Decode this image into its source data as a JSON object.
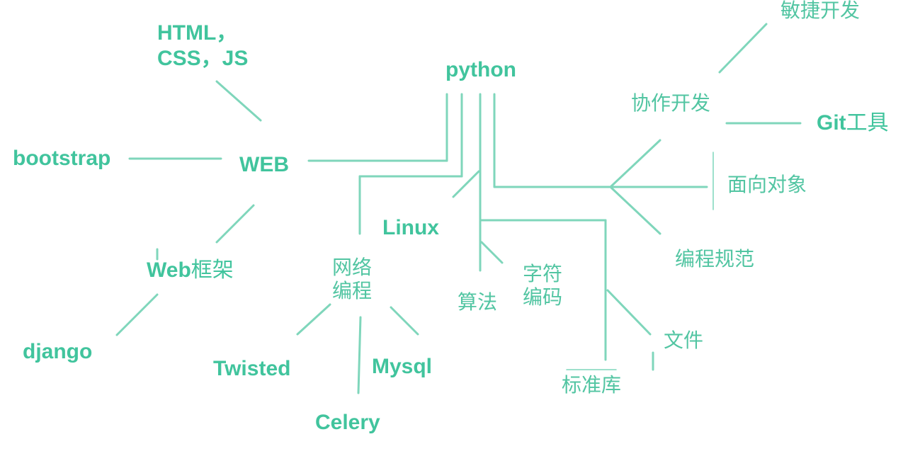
{
  "diagram": {
    "root": "python",
    "nodes": {
      "web": "WEB",
      "html_line1": "HTML，",
      "html_line2": "CSS，JS",
      "bootstrap": "bootstrap",
      "web_framework_prefix": "Web",
      "web_framework_suffix": "框架",
      "django": "django",
      "linux": "Linux",
      "network_line1": "网络",
      "network_line2": "编程",
      "twisted": "Twisted",
      "mysql": "Mysql",
      "celery": "Celery",
      "algorithm": "算法",
      "encoding_line1": "字符",
      "encoding_line2": "编码",
      "stdlib": "标准库",
      "file": "文件",
      "collaboration": "协作开发",
      "agile": "敏捷开发",
      "git_prefix": "Git",
      "git_suffix": "工具",
      "oop": "面向对象",
      "coding_style": "编程规范"
    }
  },
  "colors": {
    "text": "#41c49d",
    "line": "#7fd6bb"
  }
}
